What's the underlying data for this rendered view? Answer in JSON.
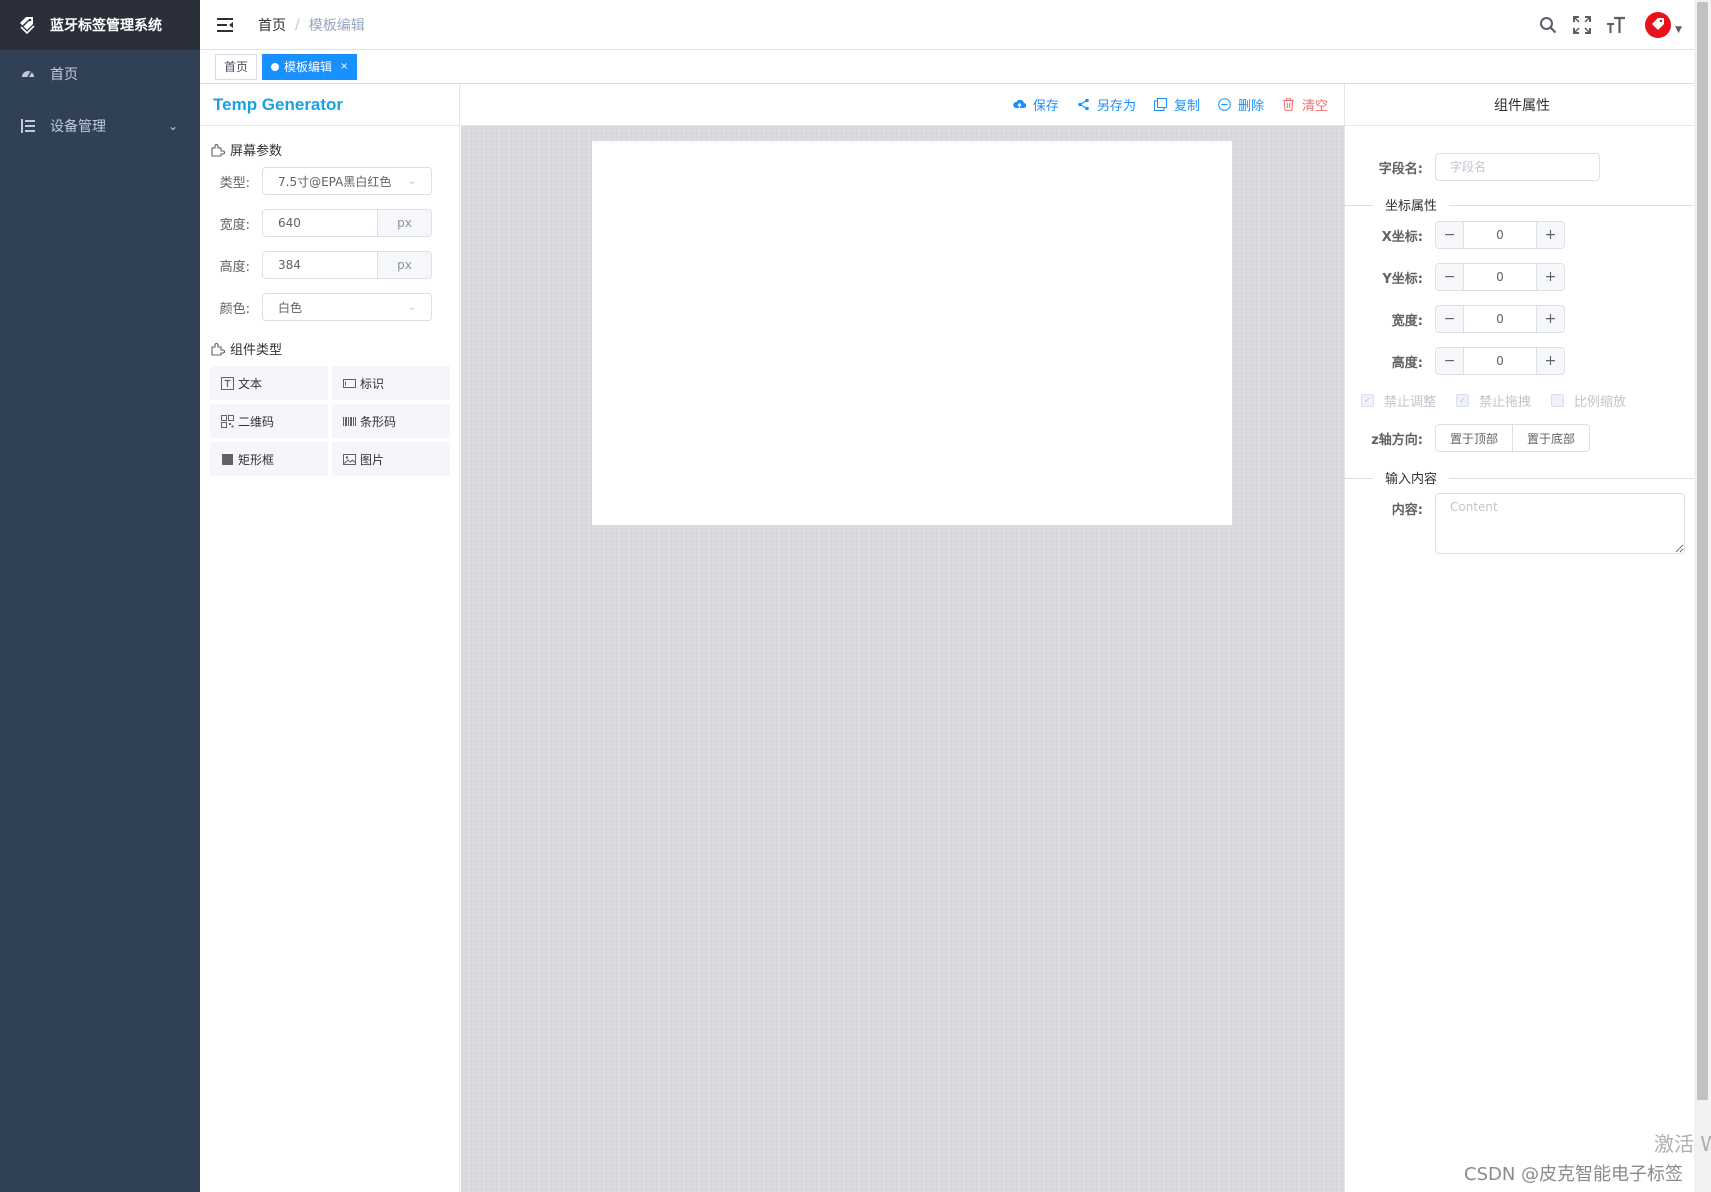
{
  "sidebar": {
    "logo_title": "蓝牙标签管理系统",
    "items": [
      {
        "label": "首页",
        "icon": "dashboard-icon"
      },
      {
        "label": "设备管理",
        "icon": "list-icon",
        "has_children": true
      }
    ]
  },
  "navbar": {
    "breadcrumb": {
      "home": "首页",
      "separator": "/",
      "current": "模板编辑"
    },
    "icons": [
      "search-icon",
      "fullscreen-icon",
      "font-size-icon"
    ],
    "avatar_color": "#e8101a"
  },
  "tags": [
    {
      "label": "首页",
      "active": false
    },
    {
      "label": "模板编辑",
      "active": true,
      "close": "×"
    }
  ],
  "left_panel": {
    "brand": "Temp Generator",
    "screen_section": "屏幕参数",
    "type_label": "类型:",
    "type_value": "7.5寸@EPA黑白红色",
    "width_label": "宽度:",
    "width_value": "640",
    "width_unit": "px",
    "height_label": "高度:",
    "height_value": "384",
    "height_unit": "px",
    "color_label": "颜色:",
    "color_value": "白色",
    "component_section": "组件类型",
    "components": [
      {
        "label": "文本",
        "icon": "text-icon"
      },
      {
        "label": "标识",
        "icon": "label-icon"
      },
      {
        "label": "二维码",
        "icon": "qrcode-icon"
      },
      {
        "label": "条形码",
        "icon": "barcode-icon"
      },
      {
        "label": "矩形框",
        "icon": "rectangle-icon"
      },
      {
        "label": "图片",
        "icon": "image-icon"
      }
    ]
  },
  "toolbar": {
    "save": "保存",
    "save_as": "另存为",
    "copy": "复制",
    "delete": "删除",
    "clear": "清空"
  },
  "right_panel": {
    "title": "组件属性",
    "field_name_label": "字段名:",
    "field_name_placeholder": "字段名",
    "coord_section": "坐标属性",
    "x_label": "X坐标:",
    "x_value": "0",
    "y_label": "Y坐标:",
    "y_value": "0",
    "w_label": "宽度:",
    "w_value": "0",
    "h_label": "高度:",
    "h_value": "0",
    "stepper_minus": "−",
    "stepper_plus": "+",
    "check_resize": "禁止调整",
    "check_drag": "禁止拖拽",
    "check_ratio": "比例缩放",
    "z_label": "z轴方向:",
    "z_top": "置于顶部",
    "z_bottom": "置于底部",
    "content_section": "输入内容",
    "content_label": "内容:",
    "content_placeholder": "Content"
  },
  "watermarks": {
    "activate": "激活 Wi",
    "csdn": "CSDN @皮克智能电子标签"
  },
  "colors": {
    "sidebar_bg": "#304156",
    "logo_bg": "#2b2f3a",
    "primary": "#1890ff",
    "danger": "#f56c6c",
    "brand": "#1ba1e2",
    "canvas_bg": "#d9dadd"
  }
}
